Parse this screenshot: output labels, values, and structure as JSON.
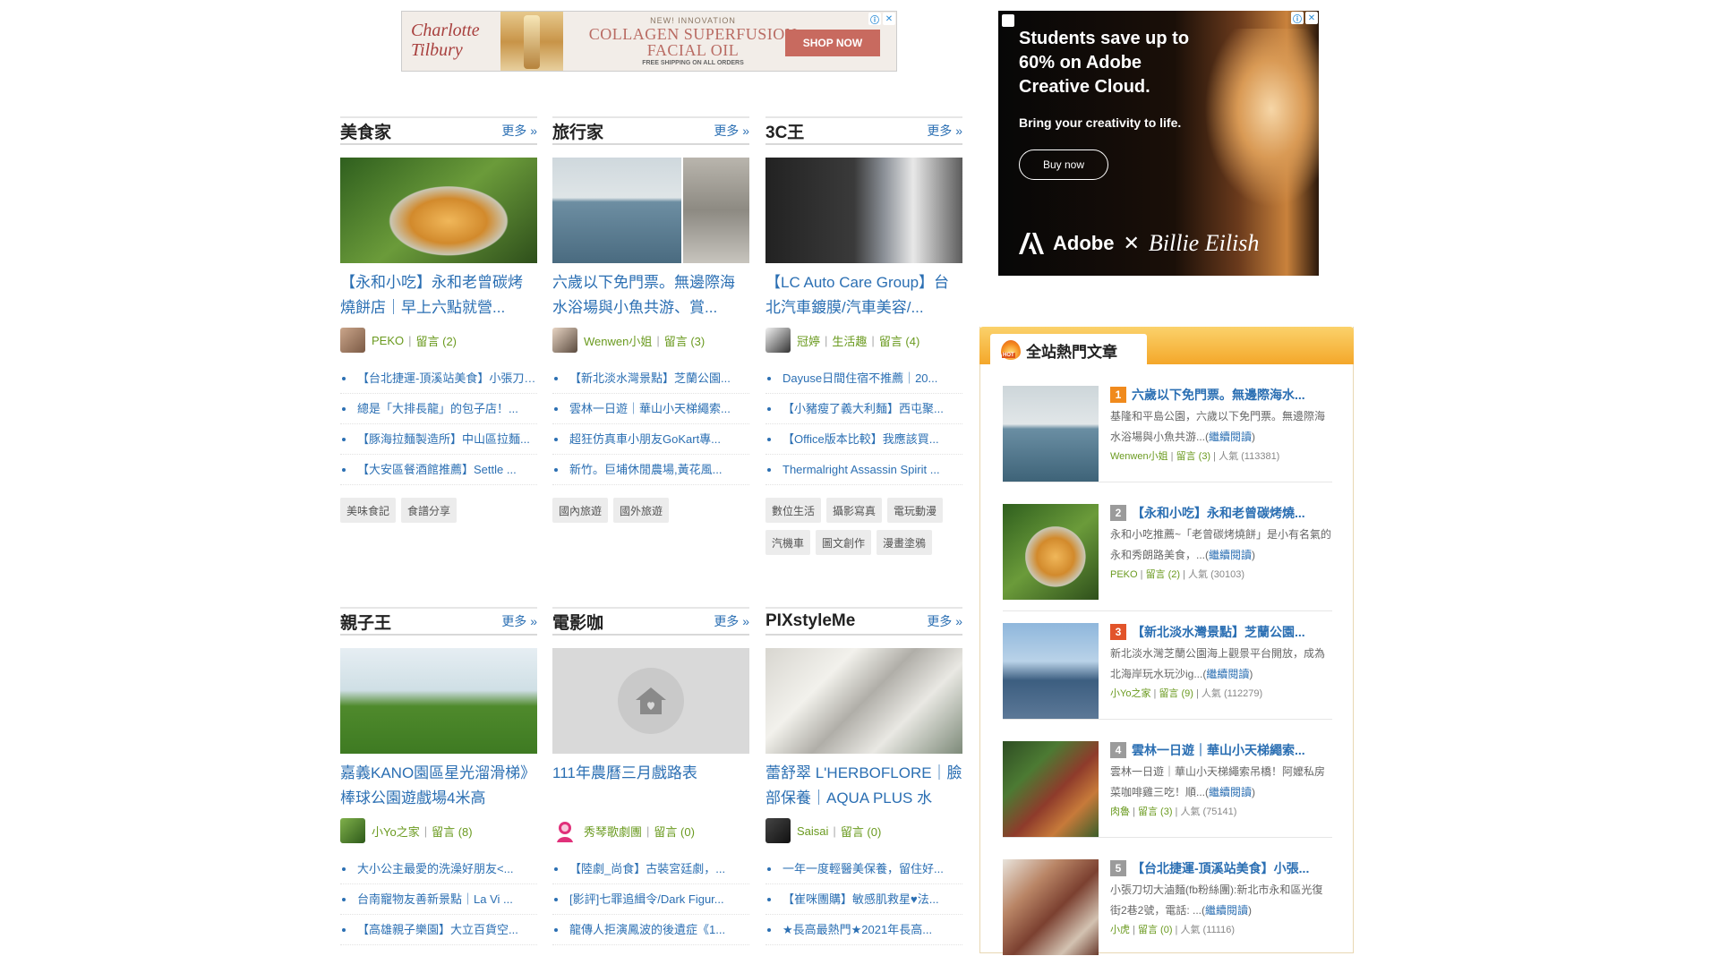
{
  "top_ad": {
    "brand": "Charlotte Tilbury",
    "kicker": "NEW! INNOVATION",
    "headline": "COLLAGEN SUPERFUSION FACIAL OIL",
    "shipping": "FREE SHIPPING ON ALL ORDERS",
    "cta": "SHOP NOW"
  },
  "side_ad": {
    "headline": "Students save up to 60% on Adobe Creative Cloud.",
    "subline": "Bring your creativity to life.",
    "cta": "Buy now",
    "brand_a": "Adobe",
    "brand_x": "✕",
    "brand_b": "Billie Eilish"
  },
  "ad_controls": {
    "info": "ⓘ",
    "close": "✕"
  },
  "categories": [
    {
      "title": "美食家",
      "more": "更多 »",
      "headline": "【永和小吃】永和老曾碳烤燒餅店｜早上六點就營...",
      "author": "PEKO",
      "comments": "留言 (2)",
      "list": [
        "【台北捷運-頂溪站美食】小張刀切大滷麵...",
        "總是「大排長龍」的包子店！...",
        "【豚海拉麵製造所】中山區拉麵...",
        "【大安區餐酒館推薦】Settle ..."
      ],
      "tags": [
        "美味食記",
        "食譜分享"
      ]
    },
    {
      "title": "旅行家",
      "more": "更多 »",
      "headline": "六歲以下免門票。無邊際海水浴場與小魚共游、賞...",
      "author": "Wenwen小姐",
      "comments": "留言 (3)",
      "list": [
        "【新北淡水灣景點】芝蘭公園...",
        "雲林一日遊｜華山小天梯繩索...",
        "超狂仿真車小朋友GoKart專...",
        "新竹。巨埔休閒農場,黃花風..."
      ],
      "tags": [
        "國內旅遊",
        "國外旅遊"
      ]
    },
    {
      "title": "3C王",
      "more": "更多 »",
      "headline": "【LC Auto Care Group】台北汽車鍍膜/汽車美容/...",
      "author": "冠婷",
      "author_sub": "生活趣",
      "comments": "留言 (4)",
      "list": [
        "Dayuse日間住宿不推薦｜20...",
        "【小豬瘦了義大利麵】西屯聚...",
        "【Office版本比較】我應該買...",
        "Thermalright Assassin Spirit ..."
      ],
      "tags": [
        "數位生活",
        "攝影寫真",
        "電玩動漫",
        "汽機車",
        "圖文創作",
        "漫畫塗鴉"
      ]
    },
    {
      "title": "親子王",
      "more": "更多 »",
      "headline": "嘉義KANO園區星光溜滑梯》棒球公園遊戲場4米高",
      "author": "小Yo之家",
      "comments": "留言 (8)",
      "list": [
        "大小公主最愛的洗澡好朋友<...",
        "台南寵物友善新景點｜La Vi ...",
        "【高雄親子樂園】大立百貨空..."
      ]
    },
    {
      "title": "電影咖",
      "more": "更多 »",
      "headline": "111年農曆三月戲路表",
      "author": "秀琴歌劇團",
      "comments": "留言 (0)",
      "list": [
        "【陸劇_尚食】古裝宮廷劇，...",
        "[影評]七罪追緝令/Dark Figur...",
        "龍傳人拒演鳳波的後遺症《1..."
      ]
    },
    {
      "title": "PIXstyleMe",
      "more": "更多 »",
      "headline": "蕾舒翠 L'HERBOFLORE｜臉部保養｜AQUA PLUS 水",
      "author": "Saisai",
      "comments": "留言 (0)",
      "list": [
        "一年一度輕醫美保養，留住好...",
        "【崔咪團購】敏感肌救星♥法...",
        "★長高最熱門★2021年長高..."
      ]
    }
  ],
  "hot": {
    "title": "全站熱門文章",
    "items": [
      {
        "rank": "1",
        "title": "六歲以下免門票。無邊際海水...",
        "excerpt": "基隆和平島公園，六歲以下免門票。無邊際海水浴場與小魚共游...",
        "more": "繼續閱讀",
        "author": "Wenwen小姐",
        "comments": "留言 (3)",
        "popularity": "人氣 (113381)"
      },
      {
        "rank": "2",
        "title": "【永和小吃】永和老曾碳烤燒...",
        "excerpt": "永和小吃推薦~「老曾碳烤燒餅」是小有名氣的永和秀朗路美食，...",
        "more": "繼續閱讀",
        "author": "PEKO",
        "comments": "留言 (2)",
        "popularity": "人氣 (30103)"
      },
      {
        "rank": "3",
        "title": "【新北淡水灣景點】芝蘭公園...",
        "excerpt": "新北淡水灣芝蘭公園海上觀景平台開放，成為北海岸玩水玩沙ig...",
        "more": "繼續閱讀",
        "author": "小Yo之家",
        "comments": "留言 (9)",
        "popularity": "人氣 (112279)"
      },
      {
        "rank": "4",
        "title": "雲林一日遊｜華山小天梯繩索...",
        "excerpt": "雲林一日遊｜華山小天梯繩索吊橋！阿嬤私房菜咖啡雞三吃！順...",
        "more": "繼續閱讀",
        "author": "肉魯",
        "comments": "留言 (3)",
        "popularity": "人氣 (75141)"
      },
      {
        "rank": "5",
        "title": "【台北捷運-頂溪站美食】小張...",
        "excerpt": "小張刀切大滷麵(fb粉絲團):新北市永和區光復街2巷2號，電話: ...",
        "more": "繼續閱讀",
        "author": "小虎",
        "comments": "留言 (0)",
        "popularity": "人氣 (11116)"
      }
    ]
  }
}
